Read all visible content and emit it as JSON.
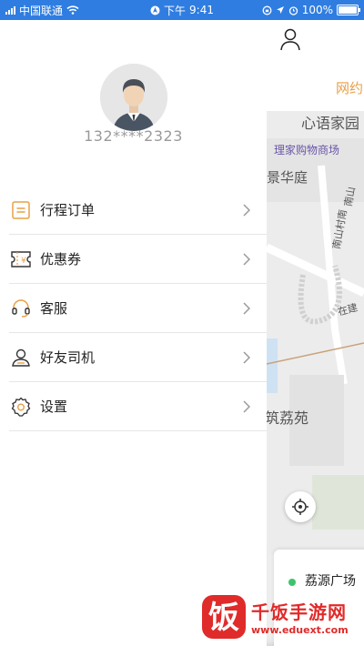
{
  "status_bar": {
    "carrier": "中国联通",
    "time_prefix": "下午",
    "time": "9:41",
    "battery": "100%"
  },
  "profile": {
    "phone": "132****2323"
  },
  "menu": {
    "items": [
      {
        "label": "行程订单",
        "icon": "itinerary-icon"
      },
      {
        "label": "优惠券",
        "icon": "coupon-icon"
      },
      {
        "label": "客服",
        "icon": "headset-icon"
      },
      {
        "label": "好友司机",
        "icon": "person-icon"
      },
      {
        "label": "设置",
        "icon": "gear-icon"
      }
    ]
  },
  "map": {
    "header_tab": "网约",
    "labels": {
      "place1": "心语家园",
      "place2": "理家购物商场",
      "place3": "景华庭",
      "place4": "南山",
      "place5": "南山村南",
      "place6": "在建",
      "place7": "筑荔苑"
    },
    "location_name": "荔源广场"
  },
  "watermark": {
    "name": "千饭手游网",
    "url": "www.eduext.com"
  },
  "colors": {
    "status_bar": "#2f7de1",
    "accent_orange": "#e8a046",
    "green_dot": "#3cc46b"
  }
}
